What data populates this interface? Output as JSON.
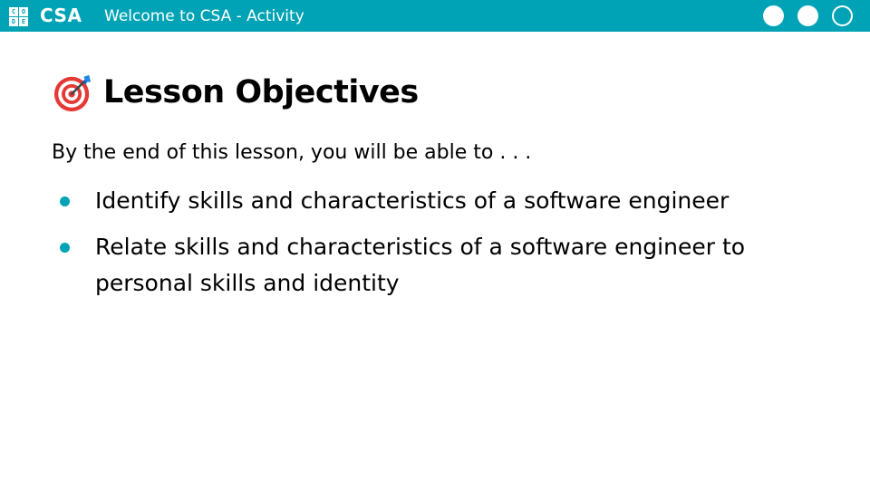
{
  "header": {
    "logo_letters": [
      "C",
      "O",
      "D",
      "E"
    ],
    "brand": "CSA",
    "deck_title": "Welcome to CSA - Activity",
    "progress_dots": [
      "filled",
      "filled",
      "outline"
    ]
  },
  "slide": {
    "icon": "target-icon",
    "heading": "Lesson Objectives",
    "intro": "By the end of this lesson, you will be able to . . .",
    "objectives": [
      "Identify skills and characteristics of a software engineer",
      "Relate skills and characteristics of a software engineer to personal skills and identity"
    ]
  },
  "colors": {
    "accent": "#00a3b5",
    "text": "#000000",
    "background": "#ffffff",
    "icon_red": "#e53935"
  }
}
